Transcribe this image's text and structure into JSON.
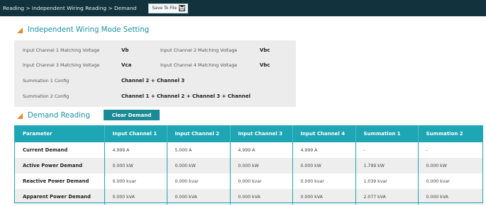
{
  "breadcrumb": "Reading > Independent Wiring Reading > Demand",
  "save_button": {
    "label": "Save To File",
    "icon": "floppy-disk-icon"
  },
  "wiring_section": {
    "title": "Independent Wiring Mode Setting",
    "rows": [
      {
        "label1": "Input Channel 1 Matching Voltage",
        "value1": "Vb",
        "label2": "Input Channel 2 Matching Voltage",
        "value2": "Vbc"
      },
      {
        "label1": "Input Channel 3 Matching Voltage",
        "value1": "Vca",
        "label2": "Input Channel 4 Matching Voltage",
        "value2": "Vbc"
      }
    ],
    "summation": [
      {
        "label": "Summation 1 Config",
        "value": "Channel 2 + Channel 3"
      },
      {
        "label": "Summation 2 Config",
        "value": "Channel 1 + Channel 2 + Channel 3 + Channel"
      }
    ]
  },
  "demand_section": {
    "title": "Demand Reading",
    "clear_button": "Clear Demand",
    "columns": [
      "Parameter",
      "Input Channel 1",
      "Input Channel 2",
      "Input Channel 3",
      "Input Channel 4",
      "Summation 1",
      "Summation 2"
    ],
    "rows": [
      [
        "Current Demand",
        "4.999 A",
        "5.000 A",
        "4.999 A",
        "4.999 A",
        "-",
        "-"
      ],
      [
        "Active Power Demand",
        "0.000 kW",
        "0.000 kW",
        "0.000 kW",
        "0.000 kW",
        "1.799 kW",
        "0.000 kW"
      ],
      [
        "Reactive Power Demand",
        "0.000 kvar",
        "0.000 kvar",
        "0.000 kvar",
        "0.000 kvar",
        "1.039 kvar",
        "0.000 kvar"
      ],
      [
        "Apparent Power Demand",
        "0.000 kVA",
        "0.000 kVA",
        "0.000 kVA",
        "0.000 kVA",
        "2.077 kVA",
        "0.000 kVA"
      ]
    ]
  },
  "colors": {
    "topbar": "#12333d",
    "accent": "#1fa6b5",
    "title": "#1d91a6",
    "marker": "#e8892a",
    "button": "#1a8a96"
  }
}
